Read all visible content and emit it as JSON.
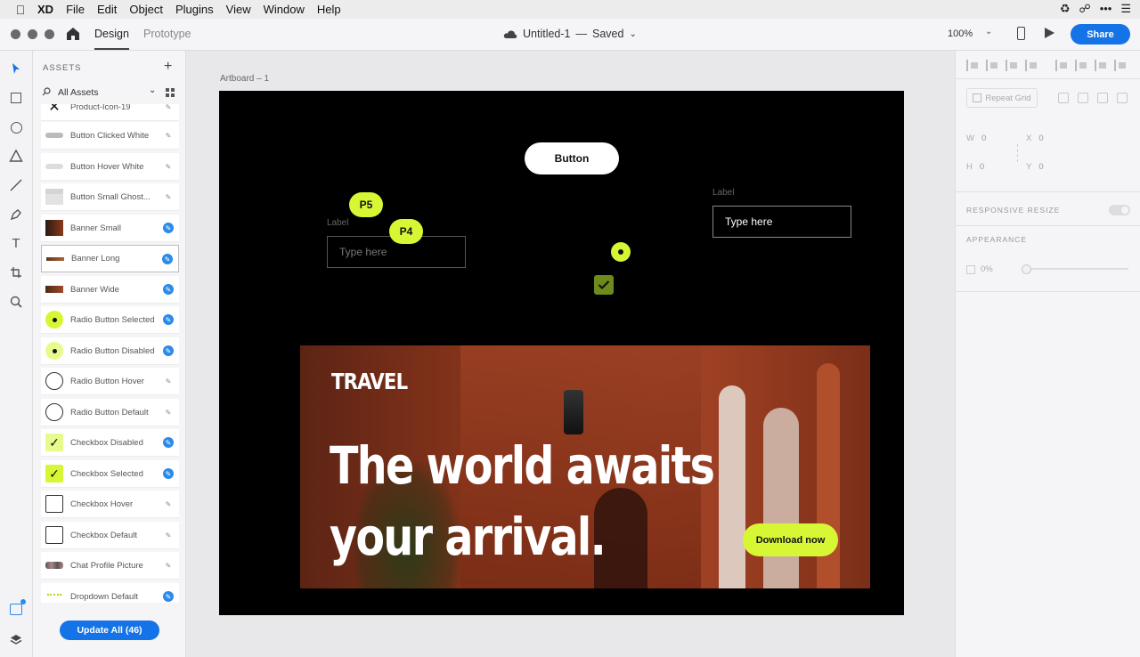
{
  "menubar": {
    "app": "XD",
    "items": [
      "File",
      "Edit",
      "Object",
      "Plugins",
      "View",
      "Window",
      "Help"
    ]
  },
  "titlebar": {
    "tabs": [
      "Design",
      "Prototype"
    ],
    "doc_title": "Untitled-1",
    "separator": "—",
    "status": "Saved",
    "zoom": "100%",
    "share": "Share"
  },
  "tools": [
    "select-tool-icon",
    "rectangle-tool-icon",
    "ellipse-tool-icon",
    "polygon-tool-icon",
    "line-tool-icon",
    "pen-tool-icon",
    "text-tool-icon",
    "artboard-tool-icon",
    "zoom-tool-icon"
  ],
  "assets": {
    "header": "ASSETS",
    "filter": "All Assets",
    "items": [
      {
        "name": "Product-Icon-19",
        "linked": false
      },
      {
        "name": "Button Clicked White",
        "linked": false
      },
      {
        "name": "Button Hover White",
        "linked": false
      },
      {
        "name": "Button Small Ghost...",
        "linked": false
      },
      {
        "name": "Banner Small",
        "linked": true
      },
      {
        "name": "Banner Long",
        "linked": true
      },
      {
        "name": "Banner Wide",
        "linked": true
      },
      {
        "name": "Radio Button Selected",
        "linked": true
      },
      {
        "name": "Radio Button Disabled",
        "linked": true
      },
      {
        "name": "Radio Button Hover",
        "linked": false
      },
      {
        "name": "Radio Button Default",
        "linked": false
      },
      {
        "name": "Checkbox Disabled",
        "linked": true
      },
      {
        "name": "Checkbox Selected",
        "linked": true
      },
      {
        "name": "Checkbox Hover",
        "linked": false
      },
      {
        "name": "Checkbox Default",
        "linked": false
      },
      {
        "name": "Chat Profile Picture",
        "linked": false
      },
      {
        "name": "Dropdown Default",
        "linked": true
      }
    ],
    "update_button": "Update All (46)"
  },
  "canvas": {
    "artboard_label": "Artboard – 1",
    "button_label": "Button",
    "label_left": "Label",
    "label_right": "Label",
    "placeholder_left": "Type here",
    "placeholder_right": "Type here",
    "pin_p5": "P5",
    "pin_p4": "P4",
    "banner": {
      "brand": "TRAVEL",
      "headline_line1": "The world awaits",
      "headline_line2": "your arrival.",
      "cta": "Download now"
    },
    "accent_color": "#d7f734"
  },
  "inspector": {
    "repeat_grid": "Repeat Grid",
    "w_label": "W",
    "w_value": "0",
    "h_label": "H",
    "h_value": "0",
    "x_label": "X",
    "x_value": "0",
    "y_label": "Y",
    "y_value": "0",
    "responsive_resize": "RESPONSIVE RESIZE",
    "appearance": "APPEARANCE",
    "opacity": "0%"
  }
}
